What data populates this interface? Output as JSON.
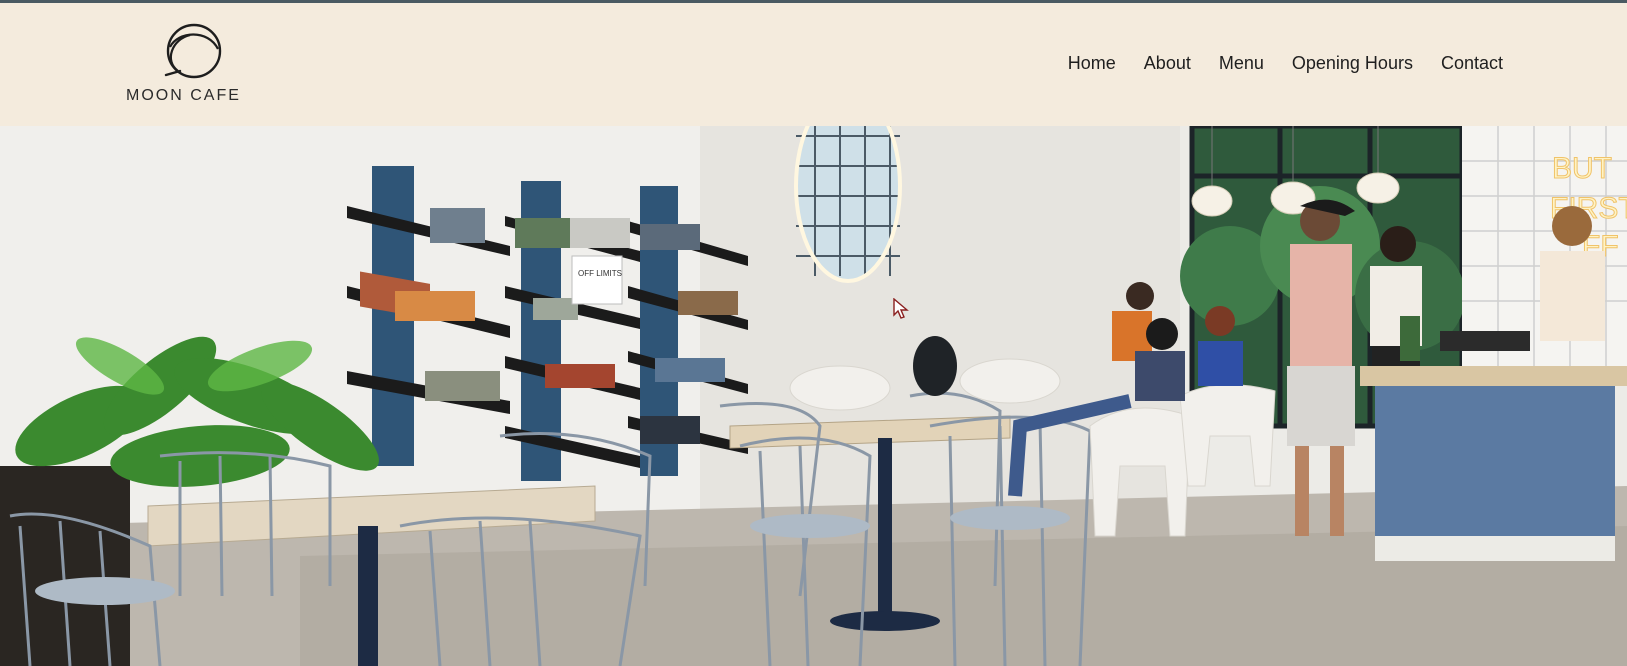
{
  "brand": {
    "name": "MOON CAFE",
    "logo_icon": "moon-cafe-logo-icon"
  },
  "nav": {
    "items": [
      {
        "label": "Home"
      },
      {
        "label": "About"
      },
      {
        "label": "Menu"
      },
      {
        "label": "Opening Hours"
      },
      {
        "label": "Contact"
      }
    ]
  },
  "hero": {
    "alt": "Moon Cafe interior with shelves of magazines, tables, chairs and customers at the counter",
    "sign_text": "OFF LIMITS",
    "neon_text": "BUT FIRST COFFEE"
  },
  "colors": {
    "header_bg": "#f4ebdd",
    "accent_blue": "#2f5577",
    "text_dark": "#1f1f1f"
  }
}
